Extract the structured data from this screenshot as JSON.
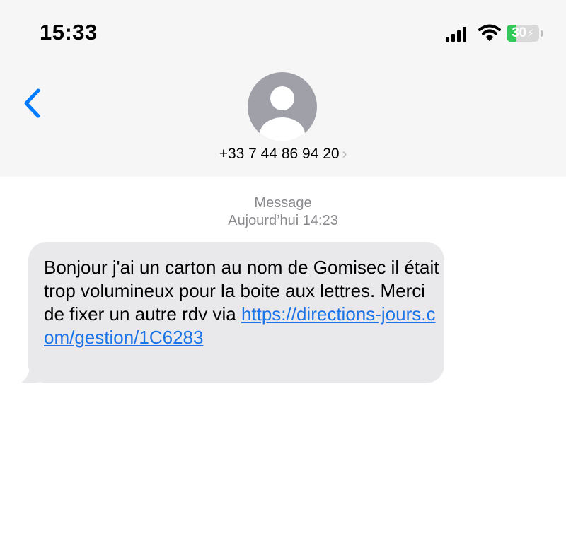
{
  "status_bar": {
    "time": "15:33",
    "battery_level": "30",
    "battery_percent": 30,
    "icons": [
      "cellular-signal-icon",
      "wifi-icon",
      "battery-charging-icon"
    ]
  },
  "nav": {
    "back_icon": "chevron-left-icon",
    "avatar_icon": "person-avatar-icon",
    "contact": "+33 7 44 86 94 20",
    "contact_chevron": "›"
  },
  "conversation": {
    "label": "Message",
    "timestamp": "Aujourd’hui 14:23",
    "message": {
      "text": "Bonjour j'ai un carton au nom de Gomisec il était trop volumineux pour la boite aux lettres. Merci de fixer un autre rdv via",
      "link": "https://directions-jours.com/gestion/1C6283"
    }
  },
  "colors": {
    "accent": "#007aff",
    "link": "#1a73e8",
    "bubble": "#e9e9eb",
    "header_bg": "#f6f6f6",
    "muted_text": "#8a8a8e",
    "battery_green": "#34c759"
  }
}
